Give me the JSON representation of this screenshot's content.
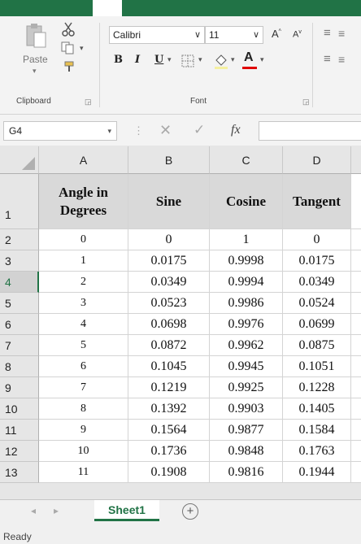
{
  "ribbon": {
    "paste_label": "Paste",
    "font_name": "Calibri",
    "font_size": "11",
    "group_clipboard": "Clipboard",
    "group_font": "Font"
  },
  "formula_bar": {
    "name_box": "G4",
    "fx_label": "fx",
    "formula_value": ""
  },
  "sheet": {
    "columns": [
      "A",
      "B",
      "C",
      "D"
    ],
    "headers": [
      "Angle in Degrees",
      "Sine",
      "Cosine",
      "Tangent"
    ],
    "rows": [
      {
        "row": "2",
        "angle": "0",
        "sine": "0",
        "cosine": "1",
        "tangent": "0"
      },
      {
        "row": "3",
        "angle": "1",
        "sine": "0.0175",
        "cosine": "0.9998",
        "tangent": "0.0175"
      },
      {
        "row": "4",
        "angle": "2",
        "sine": "0.0349",
        "cosine": "0.9994",
        "tangent": "0.0349"
      },
      {
        "row": "5",
        "angle": "3",
        "sine": "0.0523",
        "cosine": "0.9986",
        "tangent": "0.0524"
      },
      {
        "row": "6",
        "angle": "4",
        "sine": "0.0698",
        "cosine": "0.9976",
        "tangent": "0.0699"
      },
      {
        "row": "7",
        "angle": "5",
        "sine": "0.0872",
        "cosine": "0.9962",
        "tangent": "0.0875"
      },
      {
        "row": "8",
        "angle": "6",
        "sine": "0.1045",
        "cosine": "0.9945",
        "tangent": "0.1051"
      },
      {
        "row": "9",
        "angle": "7",
        "sine": "0.1219",
        "cosine": "0.9925",
        "tangent": "0.1228"
      },
      {
        "row": "10",
        "angle": "8",
        "sine": "0.1392",
        "cosine": "0.9903",
        "tangent": "0.1405"
      },
      {
        "row": "11",
        "angle": "9",
        "sine": "0.1564",
        "cosine": "0.9877",
        "tangent": "0.1584"
      },
      {
        "row": "12",
        "angle": "10",
        "sine": "0.1736",
        "cosine": "0.9848",
        "tangent": "0.1763"
      },
      {
        "row": "13",
        "angle": "11",
        "sine": "0.1908",
        "cosine": "0.9816",
        "tangent": "0.1944"
      }
    ],
    "header_row_label": "1",
    "selected_row": "4"
  },
  "tabs": {
    "sheet1": "Sheet1"
  },
  "status": {
    "text": "Ready"
  },
  "colors": {
    "accent": "#217346",
    "font_color_bar": "#e00000"
  }
}
